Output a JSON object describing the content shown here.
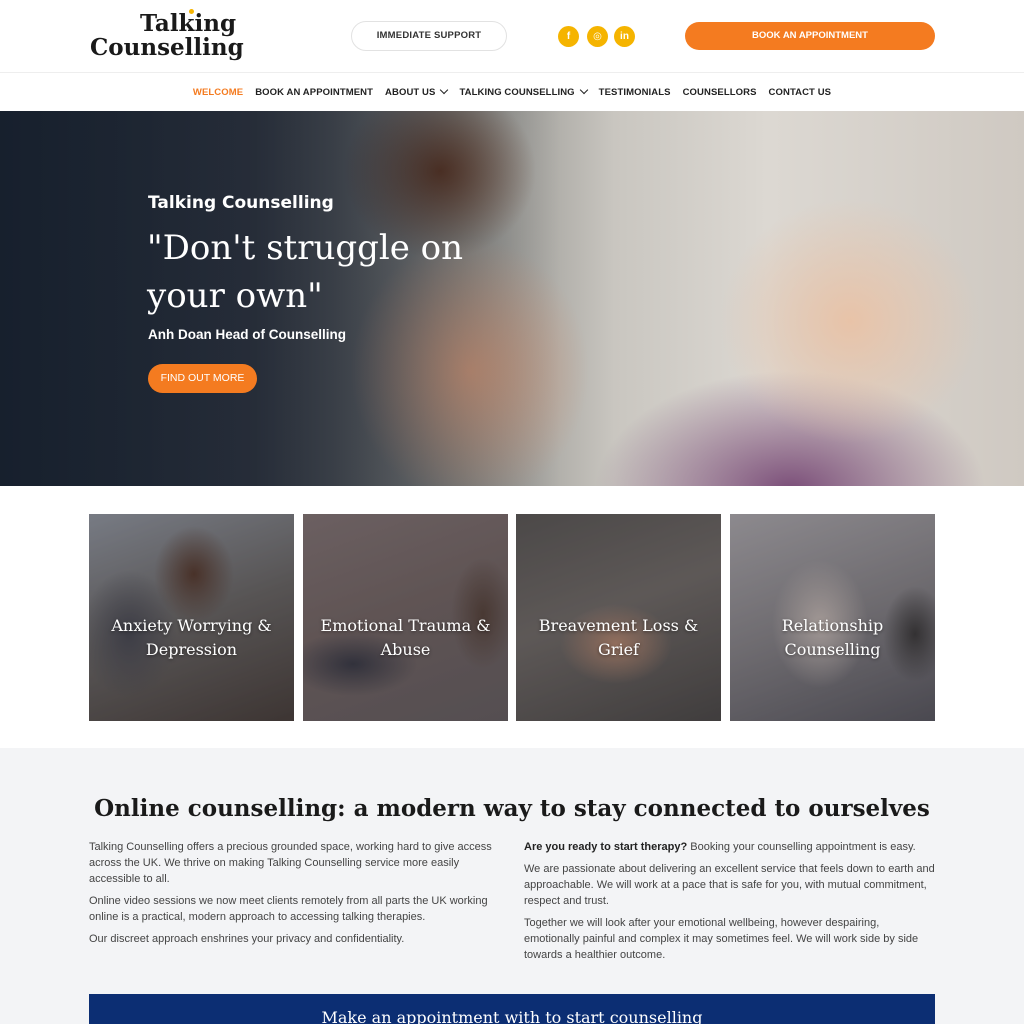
{
  "brand": {
    "line1": "Talking",
    "line2": "Counselling"
  },
  "header": {
    "support_label": "IMMEDIATE SUPPORT",
    "book_label": "BOOK AN APPOINTMENT",
    "social": [
      {
        "icon": "facebook-icon",
        "glyph": "f"
      },
      {
        "icon": "instagram-icon",
        "glyph": "◎"
      },
      {
        "icon": "linkedin-icon",
        "glyph": "in"
      }
    ]
  },
  "nav": {
    "items": [
      {
        "label": "WELCOME",
        "active": true
      },
      {
        "label": "BOOK AN APPOINTMENT"
      },
      {
        "label": "ABOUT US",
        "dropdown": true
      },
      {
        "label": "TALKING COUNSELLING",
        "dropdown": true
      },
      {
        "label": "TESTIMONIALS"
      },
      {
        "label": "COUNSELLORS"
      },
      {
        "label": "CONTACT US"
      }
    ]
  },
  "hero": {
    "eyebrow": "Talking Counselling",
    "quote": "\"Don't struggle on your own\"",
    "author": "Anh Doan Head of Counselling",
    "button": "FIND OUT MORE"
  },
  "services": [
    {
      "title": "Anxiety Worrying & Depression"
    },
    {
      "title": "Emotional Trauma & Abuse"
    },
    {
      "title": "Breavement Loss & Grief"
    },
    {
      "title": "Relationship Counselling"
    }
  ],
  "online": {
    "heading": "Online counselling: a modern way to stay connected to ourselves",
    "left": [
      "Talking Counselling offers a precious grounded space, working hard to give access across the UK. We thrive on making Talking Counselling service more easily accessible to all.",
      "Online video sessions we now meet clients remotely from all parts the UK working online is a practical, modern approach to accessing talking therapies.",
      "Our discreet approach enshrines your privacy and confidentiality."
    ],
    "right_lead_bold": "Are you ready to start therapy?",
    "right_lead_rest": " Booking your counselling appointment is easy.",
    "right": [
      "We are passionate about delivering an excellent service that feels down to earth and approachable. We will work at a pace that is safe for you, with mutual commitment, respect and trust.",
      "Together we will look after your emotional wellbeing, however despairing, emotionally painful and complex it may sometimes feel. We will work side by side towards a healthier outcome."
    ],
    "cta": "Make an appointment with to start counselling"
  },
  "colors": {
    "accent": "#f47b20",
    "social": "#f5b400",
    "cta_bg": "#0c2e73"
  }
}
